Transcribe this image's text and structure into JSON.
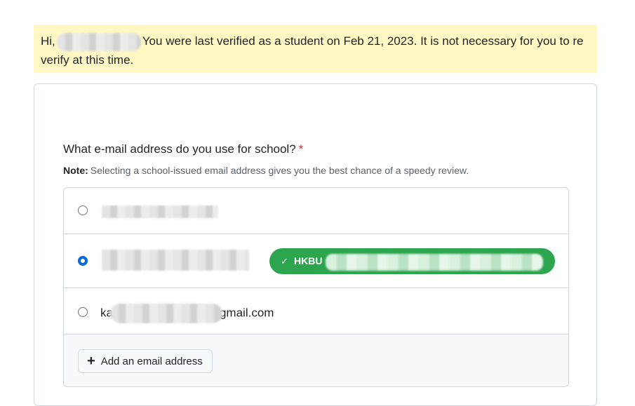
{
  "banner": {
    "greeting": "Hi,",
    "message": "You were last verified as a student on Feb 21, 2023. It is not necessary for you to re verify at this time."
  },
  "form": {
    "question": "What e-mail address do you use for school?",
    "required_mark": "*",
    "note_label": "Note:",
    "note_text": "Selecting a school-issued email address gives you the best chance of a speedy review."
  },
  "emails": [
    {
      "selected": false
    },
    {
      "selected": true,
      "badge_prefix": "HKBU",
      "badge_icon": "check-icon"
    },
    {
      "selected": false,
      "prefix": "ka",
      "suffix": "gmail.com"
    }
  ],
  "actions": {
    "add_email_label": "Add an email address",
    "add_icon": "plus-icon"
  },
  "colors": {
    "banner_bg": "#fff8c5",
    "badge_green": "#2da44e",
    "radio_blue": "#0969da",
    "required_red": "#cf222e"
  }
}
